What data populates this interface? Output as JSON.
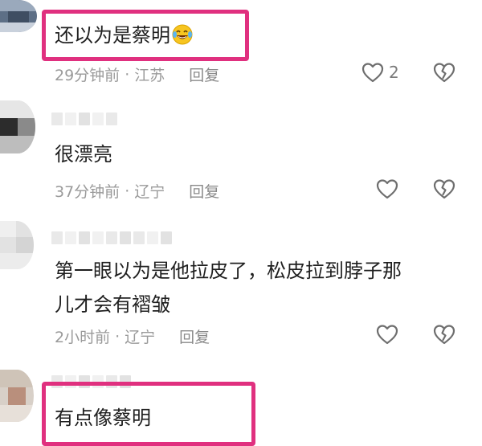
{
  "comments": [
    {
      "text": "还以为是蔡明",
      "emoji": "laughing-emoji",
      "time": "29分钟前",
      "location": "江苏",
      "reply_label": "回复",
      "likes": "2"
    },
    {
      "text": "很漂亮",
      "time": "37分钟前",
      "location": "辽宁",
      "reply_label": "回复",
      "likes": ""
    },
    {
      "text_lines": [
        "第一眼以为是他拉皮了，松皮拉到脖子那",
        "儿才会有褶皱"
      ],
      "time": "2小时前",
      "location": "辽宁",
      "reply_label": "回复",
      "likes": ""
    },
    {
      "text": "有点像蔡明"
    }
  ],
  "separator": "·",
  "icons": {
    "like": "heart-outline-icon",
    "dislike": "broken-heart-icon"
  },
  "colors": {
    "highlight": "#e0307f",
    "meta_text": "#9a9a9a"
  }
}
